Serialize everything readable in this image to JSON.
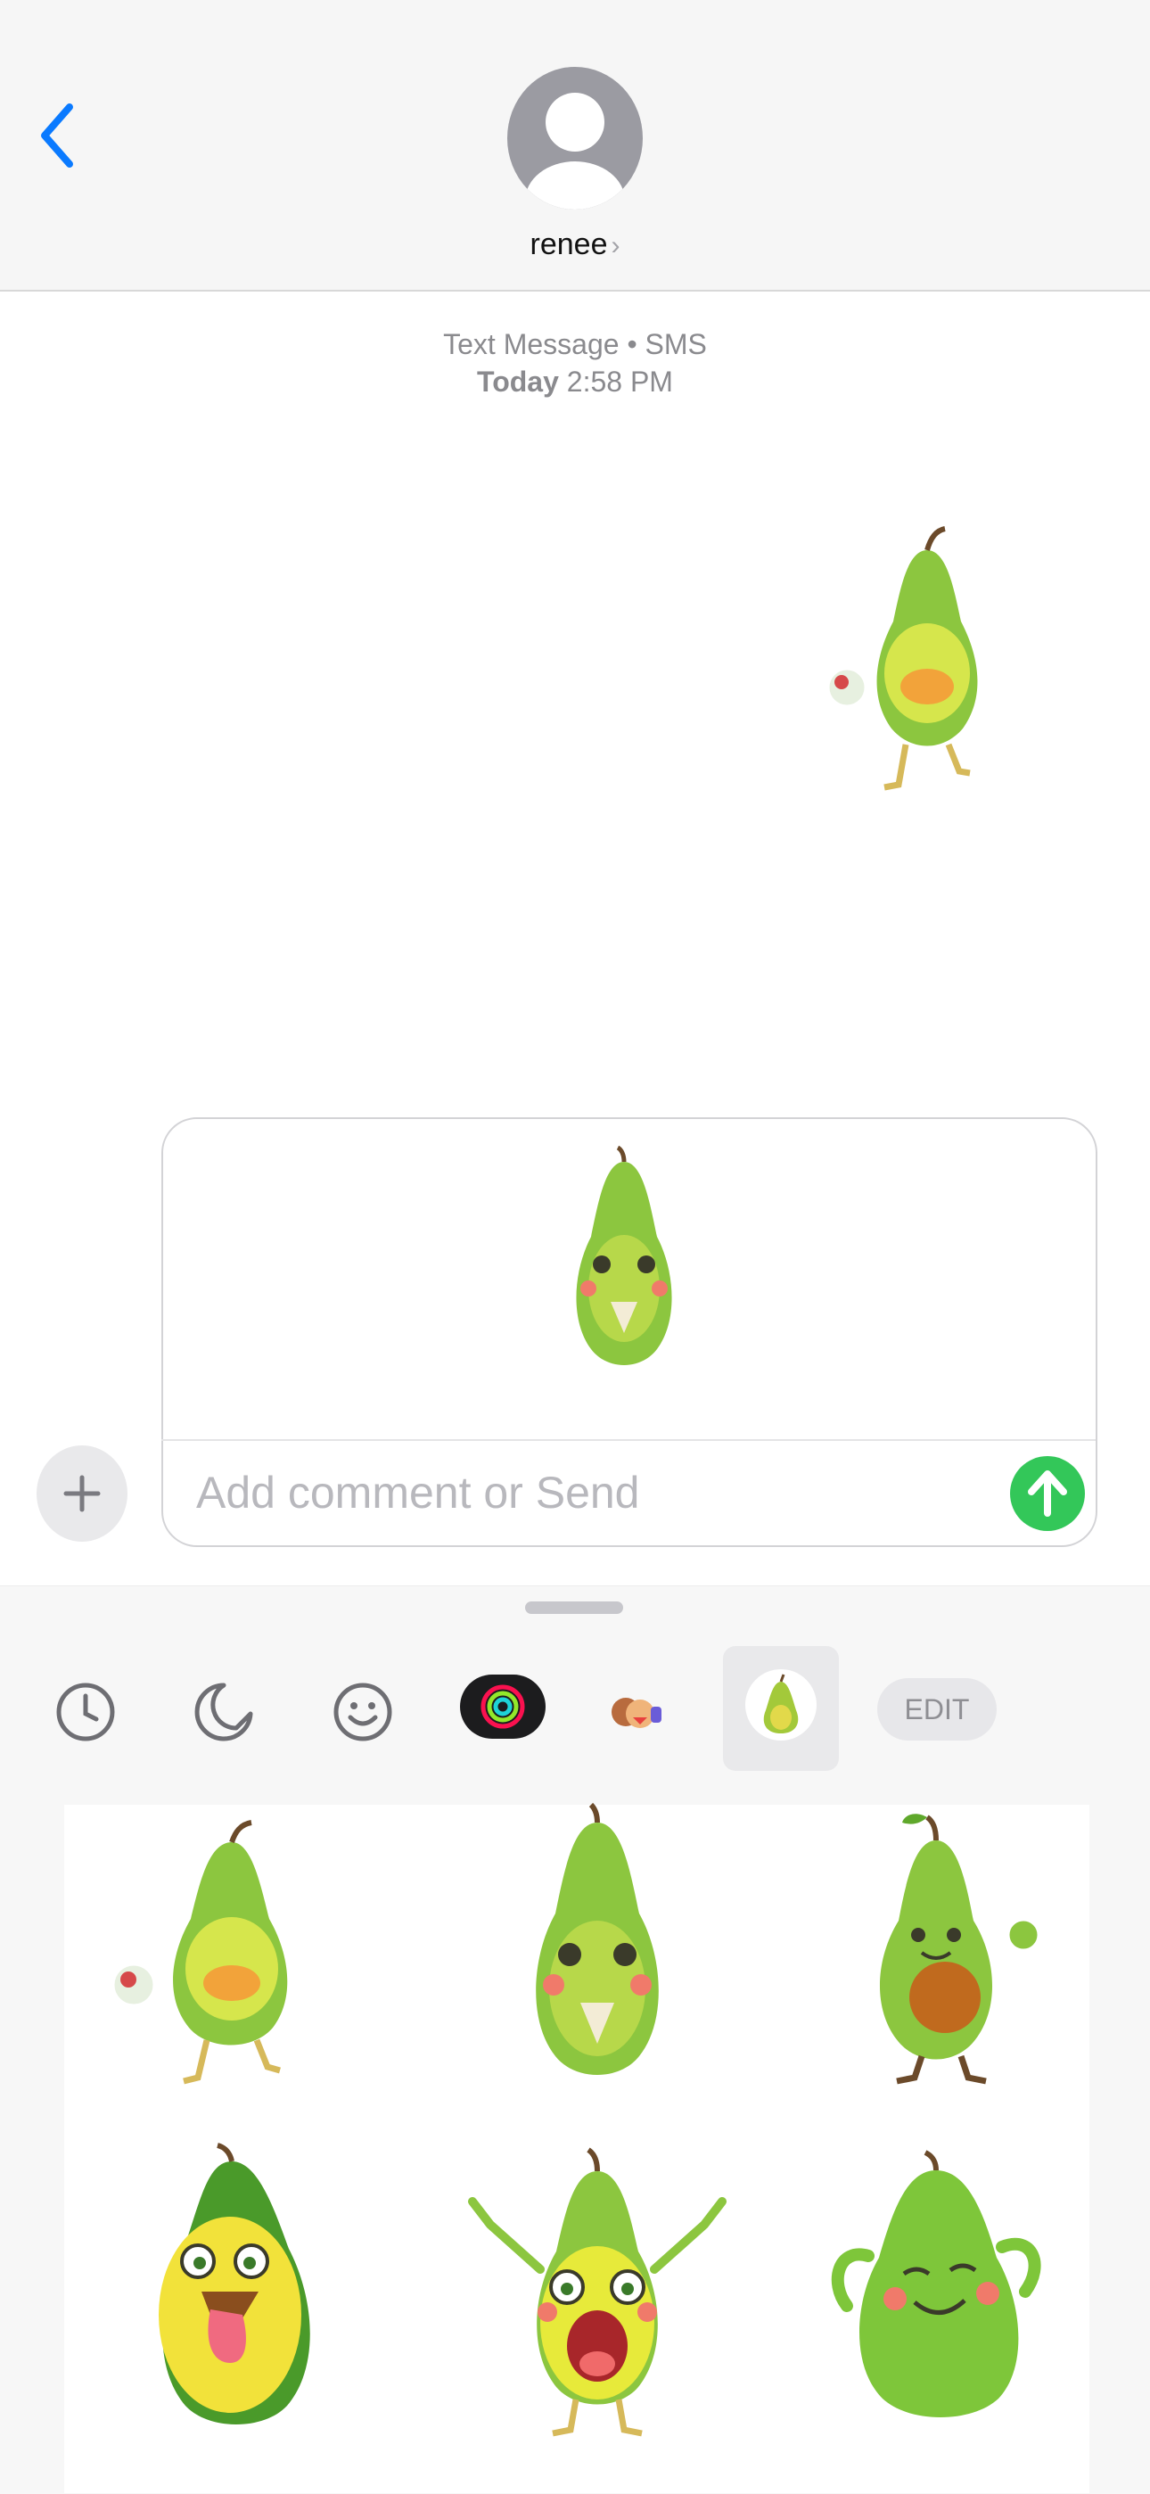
{
  "header": {
    "contact_name": "renee",
    "back_label": "Back"
  },
  "conversation": {
    "service_label": "Text Message • SMS",
    "day_label": "Today",
    "time_label": "2:58 PM",
    "sent_sticker": "avocado-running-with-ball-sticker"
  },
  "composer": {
    "placeholder": "Add comment or Send",
    "attached_sticker": "avocado-sad-with-tissue-sticker"
  },
  "sticker_drawer": {
    "tabs": [
      {
        "name": "recents-tab",
        "icon": "clock-icon"
      },
      {
        "name": "stickers-tab",
        "icon": "sticker-peel-icon"
      },
      {
        "name": "emoji-tab",
        "icon": "smiley-icon"
      },
      {
        "name": "activity-tab",
        "icon": "activity-rings-icon"
      },
      {
        "name": "memoji-tab",
        "icon": "memoji-icon"
      },
      {
        "name": "avocado-pack-tab",
        "icon": "avocado-icon",
        "selected": true
      }
    ],
    "edit_label": "EDIT",
    "stickers": [
      "avocado-running-with-ball",
      "avocado-sad-with-tissue",
      "avocado-thumbs-up",
      "avocado-tongue-out",
      "avocado-shocked-arms-up",
      "avocado-relaxed-smile"
    ]
  },
  "colors": {
    "accent_blue": "#0a7aff",
    "send_green": "#33c759",
    "avocado_skin": "#8cc63f",
    "avocado_belly": "#d6e64c"
  }
}
